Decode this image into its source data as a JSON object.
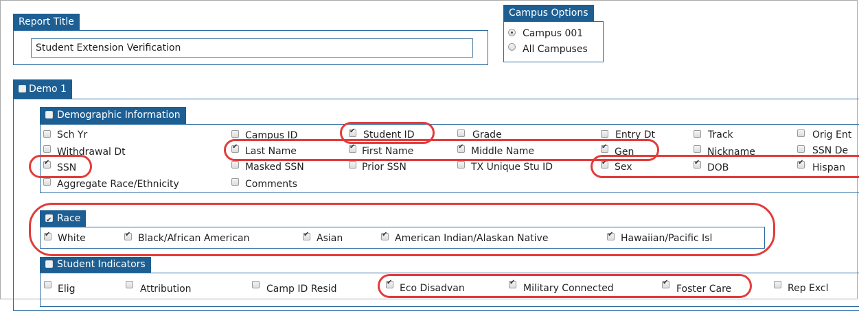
{
  "report_title": {
    "header": "Report Title",
    "value": "Student Extension Verification"
  },
  "campus_options": {
    "header": "Campus Options",
    "options": [
      {
        "label": "Campus 001",
        "selected": true
      },
      {
        "label": "All Campuses",
        "selected": false
      }
    ]
  },
  "demo1": {
    "header": "Demo 1"
  },
  "demographic": {
    "header": "Demographic Information",
    "items": [
      {
        "label": "Sch Yr",
        "checked": false
      },
      {
        "label": "Campus ID",
        "checked": false
      },
      {
        "label": "Student ID",
        "checked": true
      },
      {
        "label": "Grade",
        "checked": false
      },
      {
        "label": "Entry Dt",
        "checked": false
      },
      {
        "label": "Track",
        "checked": false
      },
      {
        "label": "Orig Ent",
        "checked": false
      },
      {
        "label": "Withdrawal Dt",
        "checked": false
      },
      {
        "label": "Last Name",
        "checked": true
      },
      {
        "label": "First Name",
        "checked": true
      },
      {
        "label": "Middle Name",
        "checked": true
      },
      {
        "label": "Gen",
        "checked": true
      },
      {
        "label": "Nickname",
        "checked": false
      },
      {
        "label": "SSN De",
        "checked": false
      },
      {
        "label": "SSN",
        "checked": true
      },
      {
        "label": "Masked SSN",
        "checked": false
      },
      {
        "label": "Prior SSN",
        "checked": false
      },
      {
        "label": "TX Unique Stu ID",
        "checked": false
      },
      {
        "label": "Sex",
        "checked": true
      },
      {
        "label": "DOB",
        "checked": true
      },
      {
        "label": "Hispan",
        "checked": true
      },
      {
        "label": "Aggregate Race/Ethnicity",
        "checked": false
      },
      {
        "label": "Comments",
        "checked": false
      }
    ]
  },
  "race": {
    "header": "Race",
    "items": [
      {
        "label": "White",
        "checked": true
      },
      {
        "label": "Black/African American",
        "checked": true
      },
      {
        "label": "Asian",
        "checked": true
      },
      {
        "label": "American Indian/Alaskan Native",
        "checked": true
      },
      {
        "label": "Hawaiian/Pacific Isl",
        "checked": true
      }
    ]
  },
  "indicators": {
    "header": "Student Indicators",
    "items": [
      {
        "label": "Elig",
        "checked": false
      },
      {
        "label": "Attribution",
        "checked": false
      },
      {
        "label": "Camp ID Resid",
        "checked": false
      },
      {
        "label": "Eco Disadvan",
        "checked": true
      },
      {
        "label": "Military Connected",
        "checked": true
      },
      {
        "label": "Foster Care",
        "checked": true
      },
      {
        "label": "Rep Excl",
        "checked": false
      }
    ]
  }
}
